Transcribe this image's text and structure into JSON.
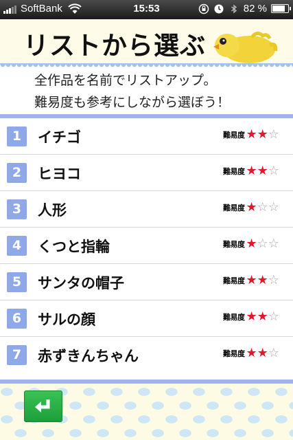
{
  "status_bar": {
    "carrier": "SoftBank",
    "time": "15:53",
    "battery": "82 %",
    "battery_level": 0.82
  },
  "header": {
    "title": "リストから選ぶ",
    "intro_line1": "全作品を名前でリストアップ。",
    "intro_line2": "難易度も参考にしながら選ぼう！"
  },
  "list": {
    "difficulty_label": "難易度",
    "items": [
      {
        "num": "1",
        "name": "イチゴ",
        "difficulty": 2
      },
      {
        "num": "2",
        "name": "ヒヨコ",
        "difficulty": 2
      },
      {
        "num": "3",
        "name": "人形",
        "difficulty": 1
      },
      {
        "num": "4",
        "name": "くつと指輪",
        "difficulty": 1
      },
      {
        "num": "5",
        "name": "サンタの帽子",
        "difficulty": 2
      },
      {
        "num": "6",
        "name": "サルの顔",
        "difficulty": 2
      },
      {
        "num": "7",
        "name": "赤ずきんちゃん",
        "difficulty": 2
      }
    ],
    "max_difficulty": 3
  },
  "footer": {
    "back_icon": "return-arrow-icon"
  },
  "colors": {
    "accent": "#8fa9e8",
    "star_on": "#e8162a",
    "button_green": "#2bb24a"
  }
}
